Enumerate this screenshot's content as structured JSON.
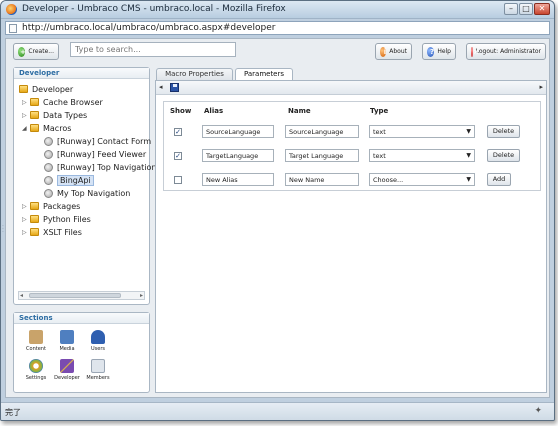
{
  "window": {
    "title": "Developer - Umbraco CMS - umbraco.local - Mozilla Firefox",
    "url": "http://umbraco.local/umbraco/umbraco.aspx#developer",
    "controls": {
      "minimize": "–",
      "maximize": "□",
      "close": "✕"
    }
  },
  "toolbar": {
    "create_label": "Create...",
    "search_placeholder": "Type to search...",
    "about_label": "About",
    "help_label": "Help",
    "logout_label": "Logout: Administrator"
  },
  "tree": {
    "heading": "Developer",
    "root_label": "Developer",
    "items": [
      {
        "label": "Cache Browser",
        "icon": "folder-icon",
        "expander": "▷"
      },
      {
        "label": "Data Types",
        "icon": "folder-icon",
        "expander": "▷"
      },
      {
        "label": "Macros",
        "icon": "folder-icon",
        "expander": "◢"
      },
      {
        "label": "[Runway] Contact Form",
        "icon": "macro-icon",
        "expander": ""
      },
      {
        "label": "[Runway] Feed Viewer",
        "icon": "macro-icon",
        "expander": ""
      },
      {
        "label": "[Runway] Top Navigation",
        "icon": "macro-icon",
        "expander": ""
      },
      {
        "label": "BingApi",
        "icon": "macro-icon",
        "expander": "",
        "selected": true
      },
      {
        "label": "My Top Navigation",
        "icon": "macro-icon",
        "expander": ""
      },
      {
        "label": "Packages",
        "icon": "folder-icon",
        "expander": "▷"
      },
      {
        "label": "Python Files",
        "icon": "folder-icon",
        "expander": "▷"
      },
      {
        "label": "XSLT Files",
        "icon": "folder-icon",
        "expander": "▷"
      }
    ],
    "scroll_left": "◂",
    "scroll_right": "▸"
  },
  "sections": {
    "heading": "Sections",
    "items": [
      {
        "label": "Content",
        "icon": "content-icon",
        "color": "#c9a36a"
      },
      {
        "label": "Media",
        "icon": "media-icon",
        "color": "#4f7fc0"
      },
      {
        "label": "Users",
        "icon": "users-icon",
        "color": "#2f5fb0"
      },
      {
        "label": "Settings",
        "icon": "settings-icon",
        "color": "#e0a020"
      },
      {
        "label": "Developer",
        "icon": "developer-icon",
        "color": "#7a4bb0"
      },
      {
        "label": "Members",
        "icon": "members-icon",
        "color": "#9aa6b4"
      }
    ]
  },
  "tabs": [
    {
      "label": "Macro Properties",
      "active": false
    },
    {
      "label": "Parameters",
      "active": true
    }
  ],
  "content_toolbar": {
    "left_arrow": "◂",
    "right_arrow": "▸"
  },
  "params": {
    "headers": {
      "show": "Show",
      "alias": "Alias",
      "name": "Name",
      "type": "Type"
    },
    "rows": [
      {
        "checked": "✓",
        "alias": "SourceLanguage",
        "name": "SourceLanguage",
        "type": "text",
        "action": "Delete"
      },
      {
        "checked": "✓",
        "alias": "TargetLanguage",
        "name": "Target Language",
        "type": "text",
        "action": "Delete"
      },
      {
        "checked": "",
        "alias": "New Alias",
        "name": "New Name",
        "type": "Choose...",
        "action": "Add"
      }
    ]
  },
  "status": {
    "text": "完了"
  }
}
